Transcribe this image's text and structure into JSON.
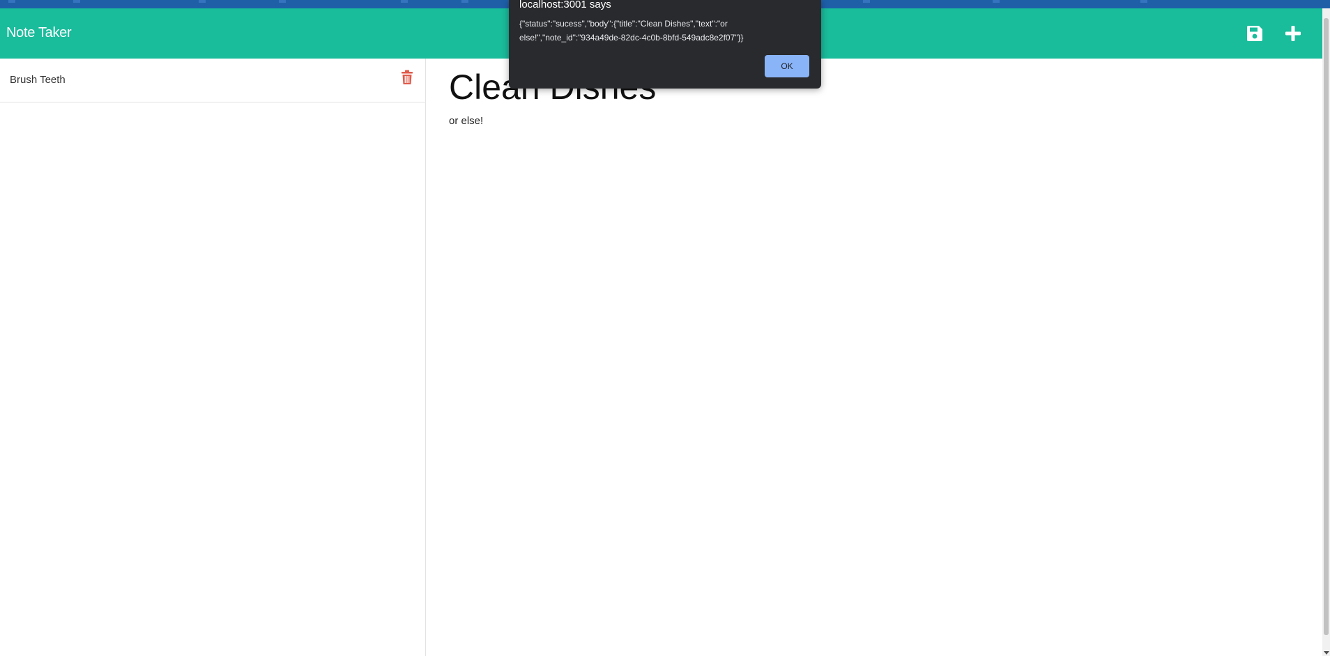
{
  "navbar": {
    "brand": "Note Taker",
    "save_icon": "floppy-disk-icon",
    "new_icon": "plus-icon",
    "color": "#19bc9b"
  },
  "sidebar": {
    "notes": [
      {
        "title": "Brush Teeth",
        "delete_icon": "trash-icon"
      }
    ]
  },
  "editor": {
    "title": "Clean Dishes",
    "text": "or else!"
  },
  "dialog": {
    "title": "localhost:3001 says",
    "message": "{\"status\":\"sucess\",\"body\":{\"title\":\"Clean Dishes\",\"text\":\"or else!\",\"note_id\":\"934a49de-82dc-4c0b-8bfd-549adc8e2f07\"}}",
    "ok_label": "OK"
  },
  "colors": {
    "accent": "#19bc9b",
    "trash": "#e05a4a",
    "dialog_bg": "#292a2d",
    "ok_button": "#8ab4f8"
  }
}
